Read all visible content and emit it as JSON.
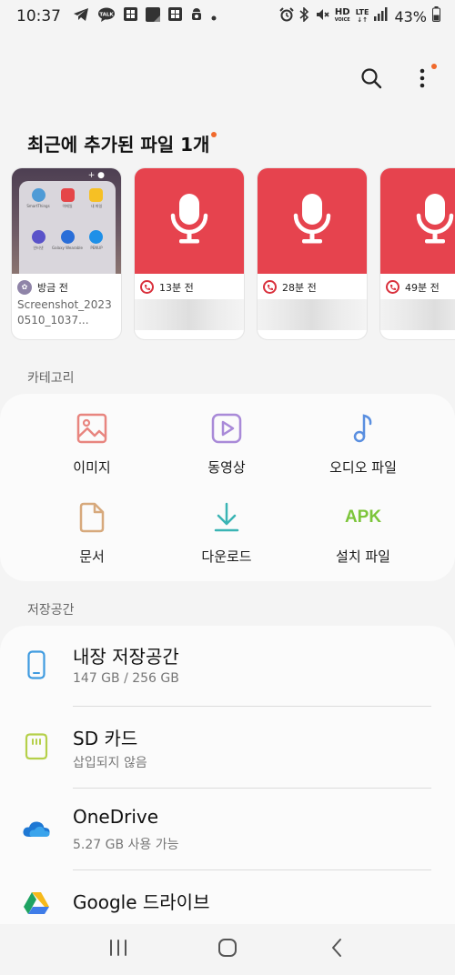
{
  "status_bar": {
    "time": "10:37",
    "battery": "43%",
    "lte": "LTE",
    "hd": "HD",
    "voice": "VOICE",
    "talk": "TALK",
    "left_icons": [
      "telegram-icon",
      "kakaotalk-icon",
      "app-grid-icon",
      "app-square-icon",
      "app-grid-icon-2",
      "android-icon",
      "more-dot-icon"
    ],
    "right_icons": [
      "alarm-icon",
      "bluetooth-icon",
      "mute-icon",
      "hd-voice-icon",
      "lte-icon",
      "signal-icon",
      "battery-icon"
    ]
  },
  "toolbar": {
    "search_icon": "search-icon",
    "more_icon": "more-vertical-icon",
    "badge_color": "#f0692c"
  },
  "recent": {
    "title": "최근에 추가된 파일 1개",
    "items": [
      {
        "time": "방금 전",
        "name": "Screenshot_20230510_1037...",
        "type": "image",
        "mini_apps": [
          "SmartThings",
          "이메일",
          "내 파일",
          "인터넷",
          "Galaxy Wearable",
          "PENUP"
        ]
      },
      {
        "time": "13분 전",
        "type": "audio"
      },
      {
        "time": "28분 전",
        "type": "audio"
      },
      {
        "time": "49분 전",
        "type": "audio"
      }
    ],
    "audio_color": "#e6434e"
  },
  "categories": {
    "label": "카테고리",
    "items": [
      {
        "label": "이미지",
        "icon": "image-icon",
        "color": "#e8857f"
      },
      {
        "label": "동영상",
        "icon": "video-icon",
        "color": "#a98ad8"
      },
      {
        "label": "오디오 파일",
        "icon": "music-note-icon",
        "color": "#5a8fe0"
      },
      {
        "label": "문서",
        "icon": "document-icon",
        "color": "#d7a97c"
      },
      {
        "label": "다운로드",
        "icon": "download-icon",
        "color": "#3ab4b4"
      },
      {
        "label": "설치 파일",
        "icon": "apk-icon",
        "icon_text": "APK",
        "color": "#7cc53a"
      }
    ]
  },
  "storage": {
    "label": "저장공간",
    "items": [
      {
        "title": "내장 저장공간",
        "sub": "147 GB / 256 GB",
        "icon": "phone-icon"
      },
      {
        "title": "SD 카드",
        "sub": "삽입되지 않음",
        "icon": "sd-card-icon"
      },
      {
        "title": "OneDrive",
        "sub": "5.27 GB 사용 가능",
        "icon": "onedrive-icon"
      },
      {
        "title": "Google 드라이브",
        "sub": "",
        "icon": "google-drive-icon"
      }
    ]
  },
  "nav": {
    "items": [
      "recents-icon",
      "home-icon",
      "back-icon"
    ]
  }
}
